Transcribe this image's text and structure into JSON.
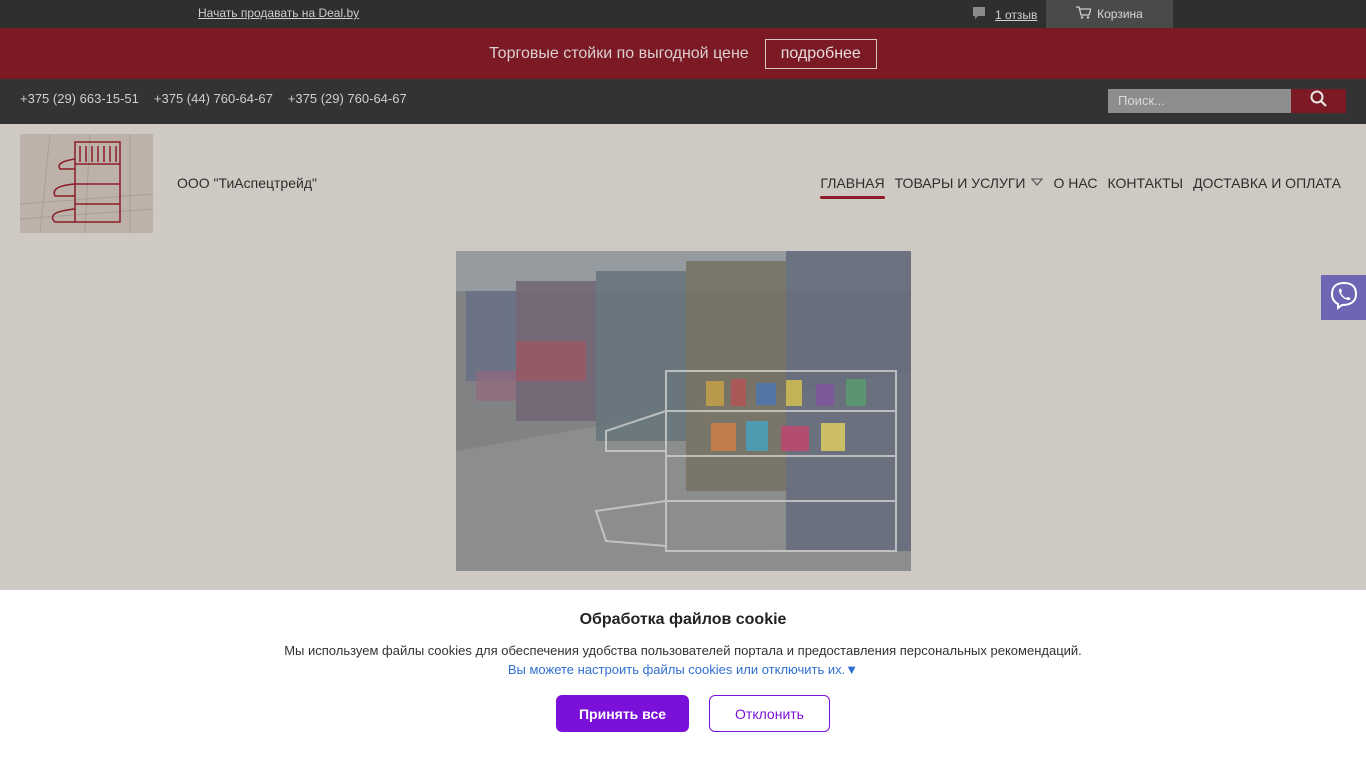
{
  "topbar": {
    "sell_link": "Начать продавать на Deal.by",
    "reviews": "1 отзыв",
    "cart": "Корзина"
  },
  "promo": {
    "text": "Торговые стойки по выгодной цене",
    "button": "подробнее"
  },
  "contacts": {
    "phones": [
      "+375 (29) 663-15-51",
      "+375 (44) 760-64-67",
      "+375 (29) 760-64-67"
    ],
    "search_placeholder": "Поиск..."
  },
  "header": {
    "company": "ООО \"ТиАспецтрейд\"",
    "nav": [
      {
        "label": "ГЛАВНАЯ",
        "active": true
      },
      {
        "label": "ТОВАРЫ И УСЛУГИ",
        "active": false
      },
      {
        "label": "О НАС",
        "active": false
      },
      {
        "label": "КОНТАКТЫ",
        "active": false
      },
      {
        "label": "ДОСТАВКА И ОПЛАТА",
        "active": false
      }
    ]
  },
  "cookie": {
    "title": "Обработка файлов cookie",
    "text": "Мы используем файлы cookies для обеспечения удобства пользователей портала и предоставления персональных рекомендаций.",
    "settings_link": "Вы можете настроить файлы cookies или отключить их.",
    "accept": "Принять все",
    "decline": "Отклонить"
  },
  "colors": {
    "promo_bg": "#7b1a24",
    "accent_purple": "#7b10d8",
    "viber": "#6c66b4"
  },
  "icons": [
    "comment-icon",
    "cart-icon",
    "search-icon",
    "chevron-down-icon",
    "viber-icon"
  ]
}
